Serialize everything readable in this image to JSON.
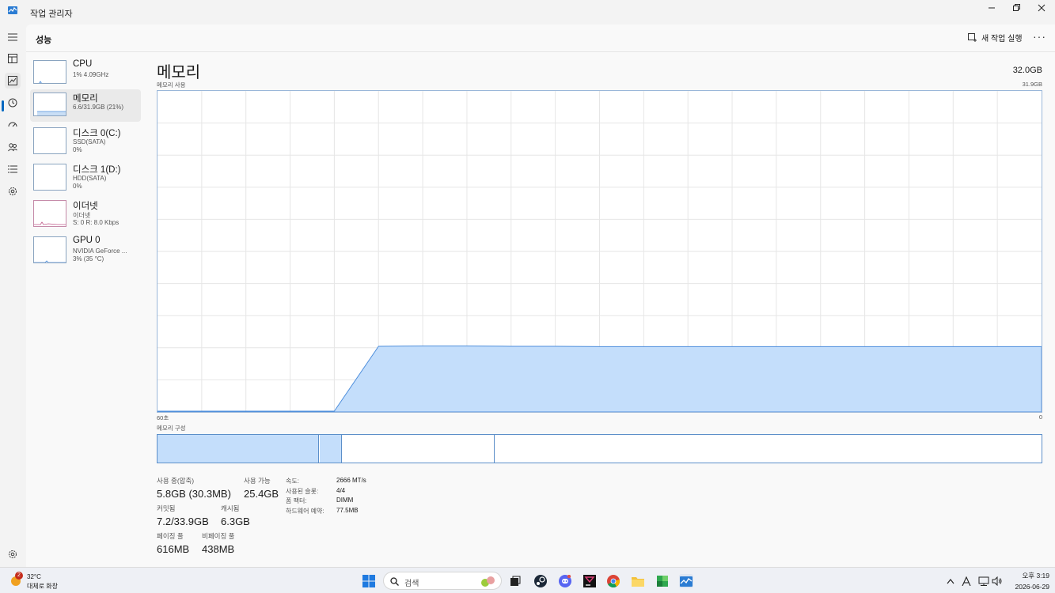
{
  "window": {
    "title": "작업 관리자"
  },
  "header": {
    "title": "성능",
    "new_task_label": "새 작업 실행"
  },
  "devices": [
    {
      "name": "CPU",
      "line1": "1% 4.09GHz",
      "line2": ""
    },
    {
      "name": "메모리",
      "line1": "6.6/31.9GB (21%)",
      "line2": ""
    },
    {
      "name": "디스크 0(C:)",
      "line1": "SSD(SATA)",
      "line2": "0%"
    },
    {
      "name": "디스크 1(D:)",
      "line1": "HDD(SATA)",
      "line2": "0%"
    },
    {
      "name": "이더넷",
      "line1": "이더넷",
      "line2": "S: 0 R: 8.0 Kbps"
    },
    {
      "name": "GPU 0",
      "line1": "NVIDIA GeForce ...",
      "line2": "3% (35 °C)"
    }
  ],
  "memory": {
    "title": "메모리",
    "total": "32.0GB",
    "usage_label": "메모리 사용",
    "usage_max": "31.9GB",
    "time_left": "60초",
    "time_right": "0",
    "composition_label": "메모리 구성",
    "usage_series_fraction": [
      0,
      0,
      0,
      0,
      0,
      0.206,
      0.207,
      0.207,
      0.206,
      0.206,
      0.205,
      0.205,
      0.205,
      0.205,
      0.205,
      0.205,
      0.205,
      0.205,
      0.205,
      0.205,
      0.205
    ],
    "composition_fractions": {
      "in_use": 0.183,
      "modified": 0.025,
      "standby": 0.172
    }
  },
  "stats": {
    "in_use_label": "사용 중(압축)",
    "in_use_value": "5.8GB (30.3MB)",
    "available_label": "사용 가능",
    "available_value": "25.4GB",
    "committed_label": "커밋됨",
    "committed_value": "7.2/33.9GB",
    "cached_label": "캐시됨",
    "cached_value": "6.3GB",
    "paged_label": "페이징 풀",
    "paged_value": "616MB",
    "nonpaged_label": "비페이징 풀",
    "nonpaged_value": "438MB"
  },
  "specs": [
    {
      "label": "속도:",
      "value": "2666 MT/s"
    },
    {
      "label": "사용된 슬롯:",
      "value": "4/4"
    },
    {
      "label": "폼 팩터:",
      "value": "DIMM"
    },
    {
      "label": "하드웨어 예약:",
      "value": "77.5MB"
    }
  ],
  "taskbar": {
    "weather_temp": "32°C",
    "weather_desc": "대체로 화창",
    "weather_badge": "2",
    "search_placeholder": "검색",
    "time": "오후 3:19",
    "date": "2026-06-29"
  },
  "colors": {
    "accent": "#0067c0",
    "mem_fill": "#c4defb",
    "mem_line": "#4f8fdc",
    "grid": "#e6e6e6"
  }
}
